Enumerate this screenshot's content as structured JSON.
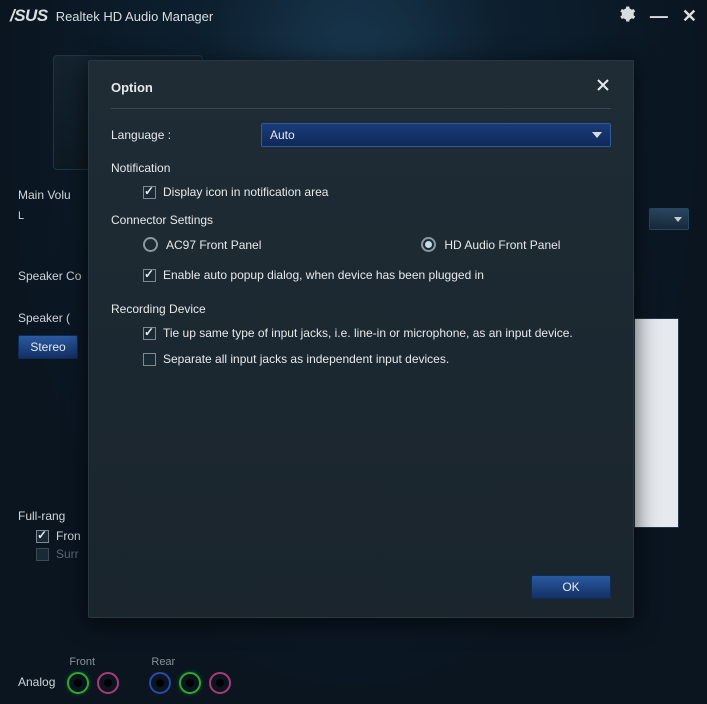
{
  "app": {
    "brand": "/SUS",
    "title": "Realtek HD Audio Manager"
  },
  "main": {
    "volume_label": "Main Volu",
    "volume_l": "L",
    "speaker_config_title": "Speaker Co",
    "speaker_sub": "Speaker (",
    "stereo_label": "Stereo",
    "full_range_label": "Full-rang",
    "front_cb_label": "Fron",
    "surround_cb_label": "Surr"
  },
  "ports": {
    "analog_label": "Analog",
    "front_label": "Front",
    "rear_label": "Rear"
  },
  "modal": {
    "title": "Option",
    "language_label": "Language :",
    "language_value": "Auto",
    "notification_label": "Notification",
    "notification_cb": "Display icon in notification area",
    "connector_label": "Connector Settings",
    "radio_ac97": "AC97 Front Panel",
    "radio_hd": "HD Audio Front Panel",
    "auto_popup_cb": "Enable auto popup dialog, when device has been plugged in",
    "recording_label": "Recording Device",
    "tie_up_cb": "Tie up same type of input jacks, i.e. line-in or microphone, as an input device.",
    "separate_cb": "Separate all input jacks as independent input devices.",
    "ok_label": "OK"
  }
}
